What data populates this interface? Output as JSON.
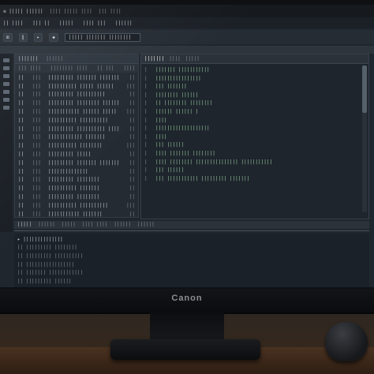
{
  "monitor": {
    "brand": "Canon"
  },
  "app": {
    "titlebar": [
      "≡ ||||| ||||||",
      "|||| ||||| ||||",
      "||| ||||"
    ],
    "menu": [
      "||  ||||",
      "|||  ||",
      "|||||",
      "||||  |||",
      "||||||"
    ],
    "toolbar": {
      "buttons": [
        "⊞",
        "∥",
        "▸",
        "◆"
      ],
      "search_value": "|||||  ||||||| ||||||||"
    }
  },
  "left_pane": {
    "header": [
      "|||||||",
      "||||||"
    ],
    "columns": [
      "|||  ||||",
      "||||||||  ||||",
      "|| |||",
      "||||"
    ],
    "rows": [
      {
        "id": "||",
        "type": "|||",
        "name": "||||||||| ||||||| |||||||",
        "size": "||"
      },
      {
        "id": "||",
        "type": "|||",
        "name": "|||||||||| ||||| ||||||",
        "size": "|||"
      },
      {
        "id": "||",
        "type": "|||",
        "name": "||||||||| ||||||||||",
        "size": "||"
      },
      {
        "id": "||",
        "type": "|||",
        "name": "||||||||| |||||||| ||||||",
        "size": "||"
      },
      {
        "id": "||",
        "type": "|||",
        "name": "||||||||||| |||||| |||||",
        "size": "|||"
      },
      {
        "id": "||",
        "type": "|||",
        "name": "|||||||||| ||||||||||",
        "size": "||"
      },
      {
        "id": "||",
        "type": "|||",
        "name": "||||||||| |||||||||| ||||",
        "size": "||"
      },
      {
        "id": "||",
        "type": "|||",
        "name": "|||||||||||| |||||||",
        "size": "||"
      },
      {
        "id": "||",
        "type": "|||",
        "name": "|||||||||| ||||||||",
        "size": "|||"
      },
      {
        "id": "||",
        "type": "|||",
        "name": "||||||||| |||||",
        "size": "||"
      },
      {
        "id": "||",
        "type": "|||",
        "name": "||||||||| ||||||| |||||||",
        "size": "||"
      },
      {
        "id": "||",
        "type": "|||",
        "name": "||||||||||||||",
        "size": "||"
      },
      {
        "id": "||",
        "type": "|||",
        "name": "||||||||| ||||||||",
        "size": "||"
      },
      {
        "id": "||",
        "type": "|||",
        "name": "|||||||||| |||||||",
        "size": "||"
      },
      {
        "id": "||",
        "type": "|||",
        "name": "||||||||| ||||||||",
        "size": "||"
      },
      {
        "id": "||",
        "type": "|||",
        "name": "|||||||||| ||||||||||",
        "size": "|||"
      },
      {
        "id": "||",
        "type": "|||",
        "name": "||||||||||| |||||||",
        "size": "||"
      }
    ]
  },
  "right_pane": {
    "tabs": [
      "|||||||",
      "||||",
      "|||||"
    ],
    "lines": [
      {
        "n": "|",
        "text": "||||||| |||||||||||"
      },
      {
        "n": "|",
        "text": "||||||||||||||||"
      },
      {
        "n": "|",
        "text": "||| |||||||"
      },
      {
        "n": "|",
        "text": "|||||||| ||||||"
      },
      {
        "n": "|",
        "text": "|| |||||||| ||||||||"
      },
      {
        "n": "|",
        "text": "|||||| |||||| |"
      },
      {
        "n": "|",
        "text": "||||"
      },
      {
        "n": "|",
        "text": "|||||||||||||||||||"
      },
      {
        "n": "|",
        "text": "||||"
      },
      {
        "n": "|",
        "text": "|||  ||||||"
      },
      {
        "n": "|",
        "text": "||||  ||||||| ||||||||"
      },
      {
        "n": "|",
        "text": "|||| ||||||||  ||||||||||||||| |||||||||||"
      },
      {
        "n": "|",
        "text": "|||  ||||||"
      },
      {
        "n": "|",
        "text": "|||   |||||||||||  ||||||||| |||||||"
      }
    ]
  },
  "bottom_panel": {
    "tabs": [
      "|||||",
      "||||||",
      "|||||",
      "|||| ||||",
      "||||||",
      "||||||"
    ],
    "lines": [
      "▸ ||||||||||||||",
      "|| ||||||||| ||||||||",
      "|| ||||||||| ||||||||||",
      "|| |||||||||||||||||",
      "|| ||||||| ||||||||||||",
      "|| ||||||||| ||||||"
    ]
  },
  "colors": {
    "editor_bg": "#1e252d",
    "code_text": "#9fd3a0",
    "ui_text": "#c9ced4"
  }
}
